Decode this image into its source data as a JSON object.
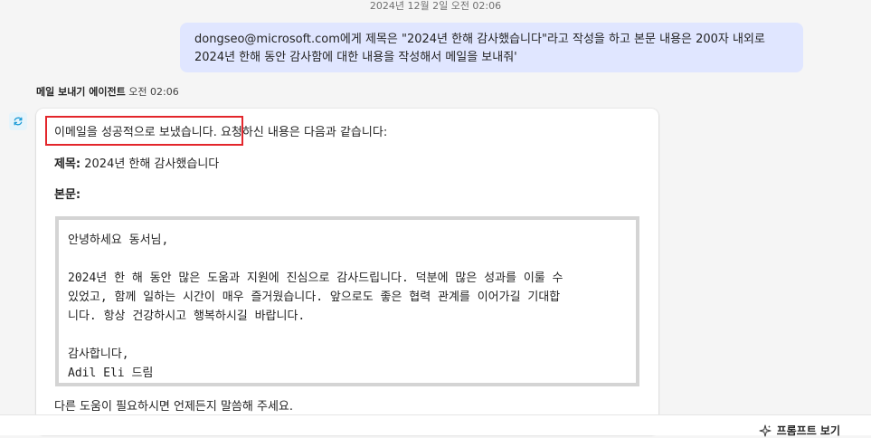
{
  "conversation": {
    "top_timestamp": "2024년 12월 2일 오전 02:06",
    "user_message": {
      "line1": "dongseo@microsoft.com에게 제목은 \"2024년 한해 감사했습니다\"라고 작성을 하고 본문 내용은 200자 내외로",
      "line2": "2024년 한해 동안 감사함에 대한 내용을 작성해서 메일을 보내줘'"
    },
    "agent": {
      "name": "메일 보내기 에이전트",
      "time": "오전 02:06",
      "status_highlight": "이메일을 성공적으로 보냈습니다.",
      "status_rest": " 요청하신 내용은 다음과 같습니다:",
      "subject_label": "제목:",
      "subject_value": " 2024년 한해 감사했습니다",
      "body_label": "본문:",
      "body_lines": {
        "greeting": "안녕하세요 동서님,",
        "p1": "2024년 한 해 동안 많은 도움과 지원에 진심으로 감사드립니다. 덕분에 많은 성과를 이룰 수",
        "p2": "있었고, 함께 일하는 시간이 매우 즐거웠습니다. 앞으로도 좋은 협력 관계를 이어가길 기대합",
        "p3": "니다. 항상 건강하시고 행복하시길 바랍니다.",
        "thanks": "감사합니다,",
        "signature": "Adil Eli 드림"
      },
      "closing": "다른 도움이 필요하시면 언제든지 말씀해 주세요."
    }
  },
  "footer": {
    "prompt_button_label": "프롬프트 보기"
  },
  "colors": {
    "user_bubble": "#e0e6ff",
    "highlight_border": "#e3262b",
    "agent_icon": "#1a9ad6"
  },
  "icons": {
    "agent_avatar": "agent-sync-icon",
    "prompt_button": "sparkle-icon"
  }
}
